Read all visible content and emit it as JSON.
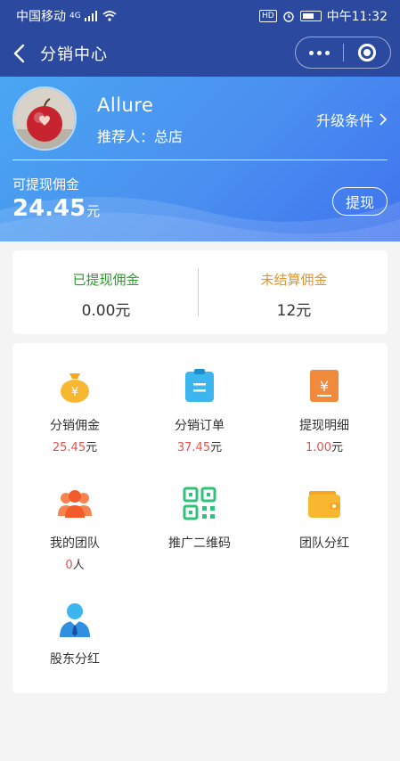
{
  "status_bar": {
    "carrier": "中国移动",
    "network": "4G",
    "hd": "HD",
    "time": "中午11:32"
  },
  "nav": {
    "title": "分销中心"
  },
  "profile": {
    "name": "Allure",
    "referrer": "推荐人：总店",
    "upgrade_label": "升级条件"
  },
  "withdrawable": {
    "label": "可提现佣金",
    "amount": "24.45",
    "unit": "元",
    "button": "提现"
  },
  "summary": {
    "withdrawn_label": "已提现佣金",
    "withdrawn_value": "0.00元",
    "unsettled_label": "未结算佣金",
    "unsettled_value": "12元",
    "withdrawn_color": "#2e9a2e",
    "unsettled_color": "#e0962a"
  },
  "menu": [
    {
      "icon": "money-bag-icon",
      "label": "分销佣金",
      "value": "25.45",
      "unit": "元"
    },
    {
      "icon": "order-clipboard-icon",
      "label": "分销订单",
      "value": "37.45",
      "unit": "元"
    },
    {
      "icon": "withdraw-detail-icon",
      "label": "提现明细",
      "value": "1.00",
      "unit": "元"
    },
    {
      "icon": "team-people-icon",
      "label": "我的团队",
      "value": "0",
      "unit": "人"
    },
    {
      "icon": "qr-code-icon",
      "label": "推广二维码"
    },
    {
      "icon": "wallet-icon",
      "label": "团队分红"
    },
    {
      "icon": "shareholder-icon",
      "label": "股东分红"
    }
  ],
  "colors": {
    "nav_bg": "#2b4a9f",
    "hero_start": "#4aa6f2",
    "hero_end": "#3f73ee",
    "amount_red": "#e85050"
  }
}
